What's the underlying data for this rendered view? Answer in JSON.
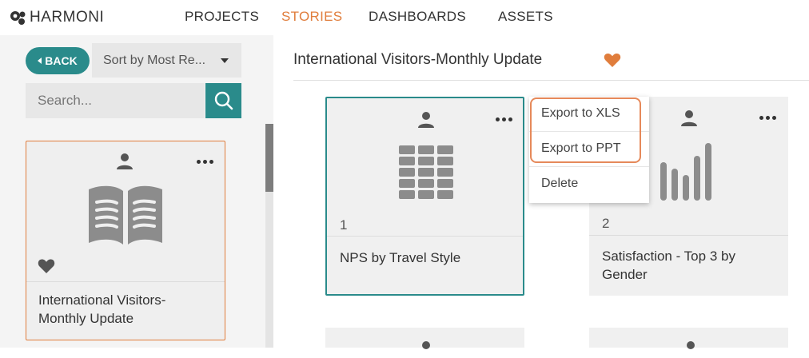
{
  "app": {
    "brand": "HARMONI"
  },
  "nav": {
    "items": [
      {
        "label": "PROJECTS"
      },
      {
        "label": "STORIES"
      },
      {
        "label": "DASHBOARDS"
      },
      {
        "label": "ASSETS"
      }
    ],
    "active": "STORIES"
  },
  "sidebar": {
    "back_label": "BACK",
    "sort_label": "Sort by Most Re...",
    "search_placeholder": "Search...",
    "story_card": {
      "title_line1": "International Visitors-",
      "title_line2": "Monthly Update",
      "favorite": true
    }
  },
  "main": {
    "title": "International Visitors-Monthly Update",
    "title_favorite": true,
    "tiles": [
      {
        "number": "1",
        "title": "NPS by Travel Style",
        "icon": "table-icon"
      },
      {
        "number": "2",
        "title_line1": "Satisfaction - Top 3 by",
        "title_line2": "Gender",
        "icon": "bar-chart-icon"
      }
    ]
  },
  "context_menu": {
    "items": [
      {
        "label": "Export to XLS"
      },
      {
        "label": "Export to PPT"
      },
      {
        "label": "Delete"
      }
    ]
  },
  "colors": {
    "accent_teal": "#2a8b8b",
    "accent_orange": "#e07d3c",
    "icon_gray": "#8c8c8c"
  }
}
